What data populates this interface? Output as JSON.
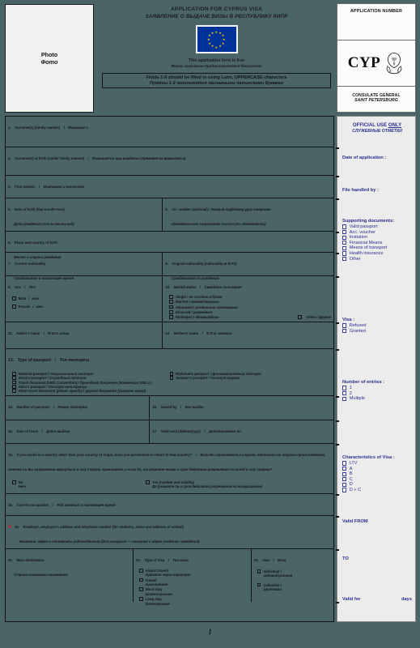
{
  "document": {
    "title_en": "APPLICATION FOR CYPRUS VISA",
    "title_ru": "ЗАЯВЛЕНИЕ О ВЫДАЧЕ ВИЗЫ В РЕСПУБЛИКУ КИПР",
    "page_number": "1",
    "background_color": "#4a6468"
  },
  "photo_box": {
    "label_en": "Photo",
    "label_ru": "Фото"
  },
  "notices": {
    "free_en": "This application form is free",
    "free_ru": "Форма заявления предоставляется бесплатно",
    "instruction_en": "Fields 1-9 should be filled in using Latin, UPPERCASE characters",
    "instruction_ru": "Пункты 1-9 заполняются заглавными латинскими буквами"
  },
  "stamp_box": {
    "application_number": "APPLICATION NUMBER",
    "country_code": "CYP",
    "emblem_icon": "cyprus-coat-of-arms-icon",
    "consulate_line1": "CONSULATE GENERAL",
    "consulate_line2": "SAINT PETERSBURG"
  },
  "eu_flag": {
    "background_color": "#003399",
    "star_color": "#ffcc00",
    "star_count": 12
  },
  "fields": [
    {
      "no": "1.",
      "en": "Surname(s) (family name/s)",
      "ru": "Фамилия/-и"
    },
    {
      "no": "2.",
      "en": "Surname(s) at birth (earlier family name/s)",
      "ru": "Фамилия/-ии при рождении  (прежняя/-ие фамилия/-и)"
    },
    {
      "no": "3.",
      "en": "First name/s",
      "ru": "Имя/имена и отчество"
    },
    {
      "no": "4.",
      "en": "Date of birth (day-month-Year)",
      "ru": "Дата рождения (число-месяц-год)"
    },
    {
      "no": "5.",
      "en": "I.D. number (optional) / Личный код/Номер удостоверения",
      "ru": "обязательного страхового полиса  (по обязанности)"
    },
    {
      "no": "6.",
      "en": "Place and country of birth",
      "ru": "Место и страна рождения"
    },
    {
      "no": "7.",
      "en": "Current nationality",
      "ru": "Гражданство в настоящее время"
    },
    {
      "no": "8.",
      "en": "Original nationality (nationality at birth)",
      "ru": "Гражданство по рождению"
    },
    {
      "no": "9.",
      "en": "Sex",
      "ru": "Пол"
    },
    {
      "no": "10.",
      "en": "Marital status",
      "ru": "Семейное положение"
    },
    {
      "no": "11.",
      "en": "Father's name",
      "ru": "Ф.И.О. отца"
    },
    {
      "no": "12.",
      "en": "Mother's name",
      "ru": "Ф.И.О. матери"
    },
    {
      "no": "13.",
      "en": "Type of passport",
      "ru": "Тип паспорта"
    },
    {
      "no": "14.",
      "en": "Number of passport",
      "ru": "Номер паспорта"
    },
    {
      "no": "15.",
      "en": "Issued by",
      "ru": "Кем выдан"
    },
    {
      "no": "16.",
      "en": "Date of issue",
      "ru": "Дата выдачи"
    },
    {
      "no": "17.",
      "en": "Valid until (dd/mm/yyyy)",
      "ru": "Действителен до"
    },
    {
      "no": "18.",
      "en": "If you reside in a country other than your country of origin, have you permission to return to that country?",
      "ru": "Если Вы проживаете в стране, отличной от страны происхождения, имеете ли Вы разрешение вернуться в эту страну проживания, и если да, то укажите номер и срок действия разрешения на въезд в эту страну?"
    },
    {
      "no": "19.",
      "en": "Current occupation",
      "ru": "Род занятий в настоящее время"
    },
    {
      "no": "20.",
      "en": "Employer, employer's address and telephone number (for students, name and address of school)",
      "ru": "Название, адрес и телефон/ы работодателя (для учащихся — название и адрес учебного заведения)"
    },
    {
      "no": "21.",
      "en": "Main destination",
      "ru": "Страна основного назначения"
    },
    {
      "no": "22.",
      "en": "Type of Visa",
      "ru": "Тип визы"
    },
    {
      "no": "23.",
      "en": "Visa",
      "ru": "Виза"
    }
  ],
  "sex_options": [
    {
      "en": "Male",
      "ru": "муж."
    },
    {
      "en": "Female",
      "ru": "жен."
    }
  ],
  "marital_options": [
    {
      "en": "Single",
      "ru": "не состою в браке"
    },
    {
      "en": "Married",
      "ru": "женат/замужем"
    },
    {
      "en": "Separated",
      "ru": "раздельное проживание"
    },
    {
      "en": "Divorced",
      "ru": "разведен/а"
    },
    {
      "en": "Widow(er)",
      "ru": "вдовец/вдова"
    }
  ],
  "marital_other": {
    "en": "Other",
    "ru": "Другое"
  },
  "passport_types_left": [
    {
      "en": "National passport",
      "ru": "Национальный паспорт"
    },
    {
      "en": "Service passport",
      "ru": "Служебный паспорт"
    },
    {
      "en": "Travel document (1951 Convention)",
      "ru": "Проездной документ  (Конвенция 1951 г.)"
    },
    {
      "en": "Alien's passport",
      "ru": "Паспорт иностранца"
    },
    {
      "en": "Other travel document (please specify)",
      "ru": "Другой документ (укажите какой)"
    }
  ],
  "passport_types_right": [
    {
      "en": "Diplomatic passport",
      "ru": "Дипломатический паспорт"
    },
    {
      "en": "Seaman's passport",
      "ru": "Паспорт моряка"
    }
  ],
  "residence_permission": {
    "no": {
      "en": "No",
      "ru": "Нет"
    },
    "yes": {
      "en": "Yes (number and validity)",
      "ru": "Да (укажите № и срок действия разрешения на возвращение)"
    }
  },
  "visa_type_options": [
    {
      "en": "Airport transit",
      "ru": "транзит через аэропорт"
    },
    {
      "en": "Transit",
      "ru": "транзитная"
    },
    {
      "en": "Short stay",
      "ru": "краткосрочная"
    },
    {
      "en": "Long stay",
      "ru": "долгосрочная"
    }
  ],
  "visa_form_options": [
    {
      "en": "Individual /",
      "ru": "индивидуальная"
    },
    {
      "en": "Collective /",
      "ru": "групповая"
    }
  ],
  "official_use": {
    "heading_main": "OFFICIAL USE ",
    "heading_underlined": "ONLY",
    "heading_ru": "СЛУЖЕБНЫЕ ОТМЕТКИ",
    "date_of_application": "Date of application :",
    "file_handled_by": "File handled by :",
    "supporting_documents_label": "Supporting documents:",
    "supporting_documents": [
      "Valid passport",
      "Acc. voucher",
      "Invitation",
      "Financial Means",
      "Means of transport",
      "Health insurance",
      "Other"
    ],
    "visa_label": "Visa :",
    "visa_options": [
      "Refused",
      "Granted"
    ],
    "entries_label": "Number of entries :",
    "entries_options": [
      "1",
      "2",
      "Multiple"
    ],
    "characteristics_label": "Characteristics of Visa :",
    "characteristics_options": [
      "LTV",
      "A",
      "B",
      "C",
      "D",
      "D + C"
    ],
    "valid_from": "Valid FROM",
    "valid_to": "TO",
    "valid_for": "Valid for",
    "valid_for_unit": "days",
    "accent_color": "#2b2f8f"
  }
}
